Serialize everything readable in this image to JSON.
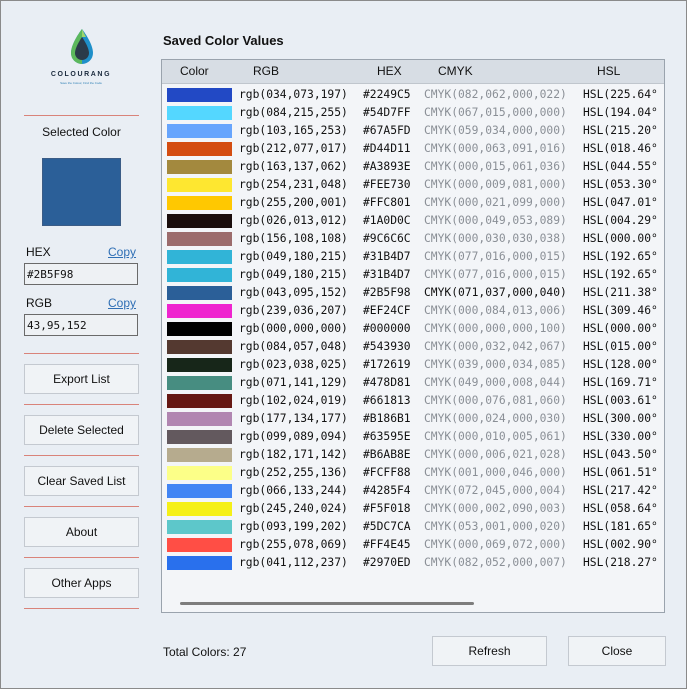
{
  "app": {
    "brand": "COLOURANG",
    "tagline": "Save the Colour, Find the Code"
  },
  "sidebar": {
    "selected_color_label": "Selected Color",
    "selected_color": "#2B5F98",
    "hex_label": "HEX",
    "hex_value": "#2B5F98",
    "rgb_label": "RGB",
    "rgb_value": "43,95,152",
    "copy_label": "Copy",
    "buttons": {
      "export": "Export List",
      "delete": "Delete Selected",
      "clear": "Clear Saved List",
      "about": "About",
      "other_apps": "Other Apps"
    }
  },
  "main": {
    "title": "Saved Color Values",
    "columns": [
      "Color",
      "RGB",
      "HEX",
      "CMYK",
      "HSL"
    ],
    "selected_index": 11,
    "rows": [
      {
        "color": "#2249C5",
        "rgb": "rgb(034,073,197)",
        "hex": "#2249C5",
        "cmyk": "CMYK(082,062,000,022)",
        "hsl": "HSL(225.64°"
      },
      {
        "color": "#54D7FF",
        "rgb": "rgb(084,215,255)",
        "hex": "#54D7FF",
        "cmyk": "CMYK(067,015,000,000)",
        "hsl": "HSL(194.04°"
      },
      {
        "color": "#67A5FD",
        "rgb": "rgb(103,165,253)",
        "hex": "#67A5FD",
        "cmyk": "CMYK(059,034,000,000)",
        "hsl": "HSL(215.20°"
      },
      {
        "color": "#D44D11",
        "rgb": "rgb(212,077,017)",
        "hex": "#D44D11",
        "cmyk": "CMYK(000,063,091,016)",
        "hsl": "HSL(018.46°"
      },
      {
        "color": "#A3893E",
        "rgb": "rgb(163,137,062)",
        "hex": "#A3893E",
        "cmyk": "CMYK(000,015,061,036)",
        "hsl": "HSL(044.55°"
      },
      {
        "color": "#FEE730",
        "rgb": "rgb(254,231,048)",
        "hex": "#FEE730",
        "cmyk": "CMYK(000,009,081,000)",
        "hsl": "HSL(053.30°"
      },
      {
        "color": "#FFC801",
        "rgb": "rgb(255,200,001)",
        "hex": "#FFC801",
        "cmyk": "CMYK(000,021,099,000)",
        "hsl": "HSL(047.01°"
      },
      {
        "color": "#1A0D0C",
        "rgb": "rgb(026,013,012)",
        "hex": "#1A0D0C",
        "cmyk": "CMYK(000,049,053,089)",
        "hsl": "HSL(004.29°"
      },
      {
        "color": "#9C6C6C",
        "rgb": "rgb(156,108,108)",
        "hex": "#9C6C6C",
        "cmyk": "CMYK(000,030,030,038)",
        "hsl": "HSL(000.00°"
      },
      {
        "color": "#31B4D7",
        "rgb": "rgb(049,180,215)",
        "hex": "#31B4D7",
        "cmyk": "CMYK(077,016,000,015)",
        "hsl": "HSL(192.65°"
      },
      {
        "color": "#31B4D7",
        "rgb": "rgb(049,180,215)",
        "hex": "#31B4D7",
        "cmyk": "CMYK(077,016,000,015)",
        "hsl": "HSL(192.65°"
      },
      {
        "color": "#2B5F98",
        "rgb": "rgb(043,095,152)",
        "hex": "#2B5F98",
        "cmyk": "CMYK(071,037,000,040)",
        "hsl": "HSL(211.38°"
      },
      {
        "color": "#EF24CF",
        "rgb": "rgb(239,036,207)",
        "hex": "#EF24CF",
        "cmyk": "CMYK(000,084,013,006)",
        "hsl": "HSL(309.46°"
      },
      {
        "color": "#000000",
        "rgb": "rgb(000,000,000)",
        "hex": "#000000",
        "cmyk": "CMYK(000,000,000,100)",
        "hsl": "HSL(000.00°"
      },
      {
        "color": "#543930",
        "rgb": "rgb(084,057,048)",
        "hex": "#543930",
        "cmyk": "CMYK(000,032,042,067)",
        "hsl": "HSL(015.00°"
      },
      {
        "color": "#172619",
        "rgb": "rgb(023,038,025)",
        "hex": "#172619",
        "cmyk": "CMYK(039,000,034,085)",
        "hsl": "HSL(128.00°"
      },
      {
        "color": "#478D81",
        "rgb": "rgb(071,141,129)",
        "hex": "#478D81",
        "cmyk": "CMYK(049,000,008,044)",
        "hsl": "HSL(169.71°"
      },
      {
        "color": "#661813",
        "rgb": "rgb(102,024,019)",
        "hex": "#661813",
        "cmyk": "CMYK(000,076,081,060)",
        "hsl": "HSL(003.61°"
      },
      {
        "color": "#B186B1",
        "rgb": "rgb(177,134,177)",
        "hex": "#B186B1",
        "cmyk": "CMYK(000,024,000,030)",
        "hsl": "HSL(300.00°"
      },
      {
        "color": "#63595E",
        "rgb": "rgb(099,089,094)",
        "hex": "#63595E",
        "cmyk": "CMYK(000,010,005,061)",
        "hsl": "HSL(330.00°"
      },
      {
        "color": "#B6AB8E",
        "rgb": "rgb(182,171,142)",
        "hex": "#B6AB8E",
        "cmyk": "CMYK(000,006,021,028)",
        "hsl": "HSL(043.50°"
      },
      {
        "color": "#FCFF88",
        "rgb": "rgb(252,255,136)",
        "hex": "#FCFF88",
        "cmyk": "CMYK(001,000,046,000)",
        "hsl": "HSL(061.51°"
      },
      {
        "color": "#4285F4",
        "rgb": "rgb(066,133,244)",
        "hex": "#4285F4",
        "cmyk": "CMYK(072,045,000,004)",
        "hsl": "HSL(217.42°"
      },
      {
        "color": "#F5F018",
        "rgb": "rgb(245,240,024)",
        "hex": "#F5F018",
        "cmyk": "CMYK(000,002,090,003)",
        "hsl": "HSL(058.64°"
      },
      {
        "color": "#5DC7CA",
        "rgb": "rgb(093,199,202)",
        "hex": "#5DC7CA",
        "cmyk": "CMYK(053,001,000,020)",
        "hsl": "HSL(181.65°"
      },
      {
        "color": "#FF4E45",
        "rgb": "rgb(255,078,069)",
        "hex": "#FF4E45",
        "cmyk": "CMYK(000,069,072,000)",
        "hsl": "HSL(002.90°"
      },
      {
        "color": "#2970ED",
        "rgb": "rgb(041,112,237)",
        "hex": "#2970ED",
        "cmyk": "CMYK(082,052,000,007)",
        "hsl": "HSL(218.27°"
      }
    ]
  },
  "footer": {
    "total_label": "Total Colors: 27",
    "refresh": "Refresh",
    "close": "Close"
  }
}
